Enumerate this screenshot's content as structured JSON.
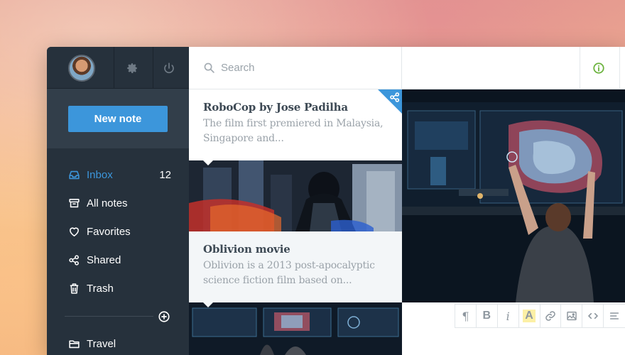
{
  "sidebar": {
    "new_note_label": "New note",
    "items": [
      {
        "label": "Inbox",
        "icon": "inbox-icon",
        "count": "12",
        "active": true
      },
      {
        "label": "All notes",
        "icon": "archive-icon"
      },
      {
        "label": "Favorites",
        "icon": "heart-icon"
      },
      {
        "label": "Shared",
        "icon": "share-icon"
      },
      {
        "label": "Trash",
        "icon": "trash-icon"
      }
    ],
    "folders": [
      {
        "label": "Travel",
        "icon": "folder-icon"
      }
    ]
  },
  "search": {
    "placeholder": "Search"
  },
  "notes": [
    {
      "title": "RoboCop by Jose Padilha",
      "excerpt": "The film first premiered in Malaysia, Singapore and...",
      "shared": true
    },
    {
      "title": "Oblivion movie",
      "excerpt": "Oblivion is a 2013 post-apocalyptic science fiction film based on..."
    }
  ],
  "toolbar": {
    "tools": [
      "¶",
      "B",
      "i",
      "A"
    ]
  },
  "colors": {
    "accent": "#3c96db",
    "sidebar_bg": "#26313c",
    "info_green": "#6cb33e"
  }
}
